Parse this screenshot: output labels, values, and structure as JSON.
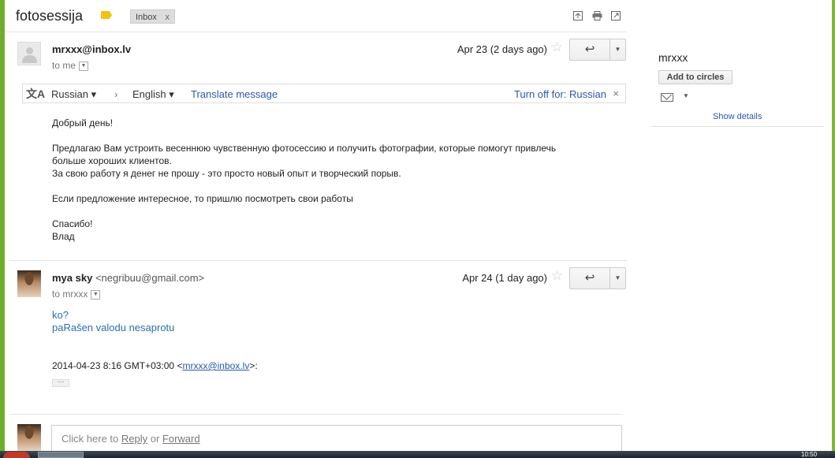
{
  "thread": {
    "subject": "fotosessija",
    "label": "Inbox",
    "label_close": "x",
    "label_color": "#f2c40f"
  },
  "header_icons": [
    "popout-icon",
    "print-icon",
    "new-window-icon"
  ],
  "messages": [
    {
      "sender": "mrxxx@inbox.lv",
      "sender_email": "",
      "to": "to me",
      "date": "Apr 23 (2 days ago)",
      "body": [
        "Добрый день!",
        "",
        "Предлагаю Вам устроить весеннюю чувственную фотосессию и получить фотографии, которые помогут привлечь",
        "больше хороших клиентов.",
        "За свою работу я денег не прошу - это просто новый опыт и творческий порыв.",
        "",
        "Если предложение интересное, то пришлю посмотреть свои работы",
        "",
        "Спасибо!",
        "Влад"
      ]
    },
    {
      "sender": "mya sky",
      "sender_email": "<negribuu@gmail.com>",
      "to": "to mrxxx",
      "date": "Apr 24 (1 day ago)",
      "body": [
        "ko?",
        "paRašen valodu nesaprotu"
      ],
      "quote_header_prefix": "2014-04-23 8:16 GMT+03:00 <",
      "quote_header_link": "mrxxx@inbox.lv",
      "quote_header_suffix": ">:",
      "ellipsis": "···"
    }
  ],
  "translate_bar": {
    "from": "Russian",
    "to": "English",
    "action": "Translate message",
    "turn_off": "Turn off for: Russian",
    "close": "×"
  },
  "reply_box": {
    "prefix": "Click here to ",
    "reply": "Reply",
    "or": " or ",
    "forward": "Forward"
  },
  "sidebar": {
    "name": "mrxxx",
    "add_to_circles": "Add to circles",
    "show_details": "Show details"
  },
  "taskbar": {
    "clock": "10:50"
  }
}
